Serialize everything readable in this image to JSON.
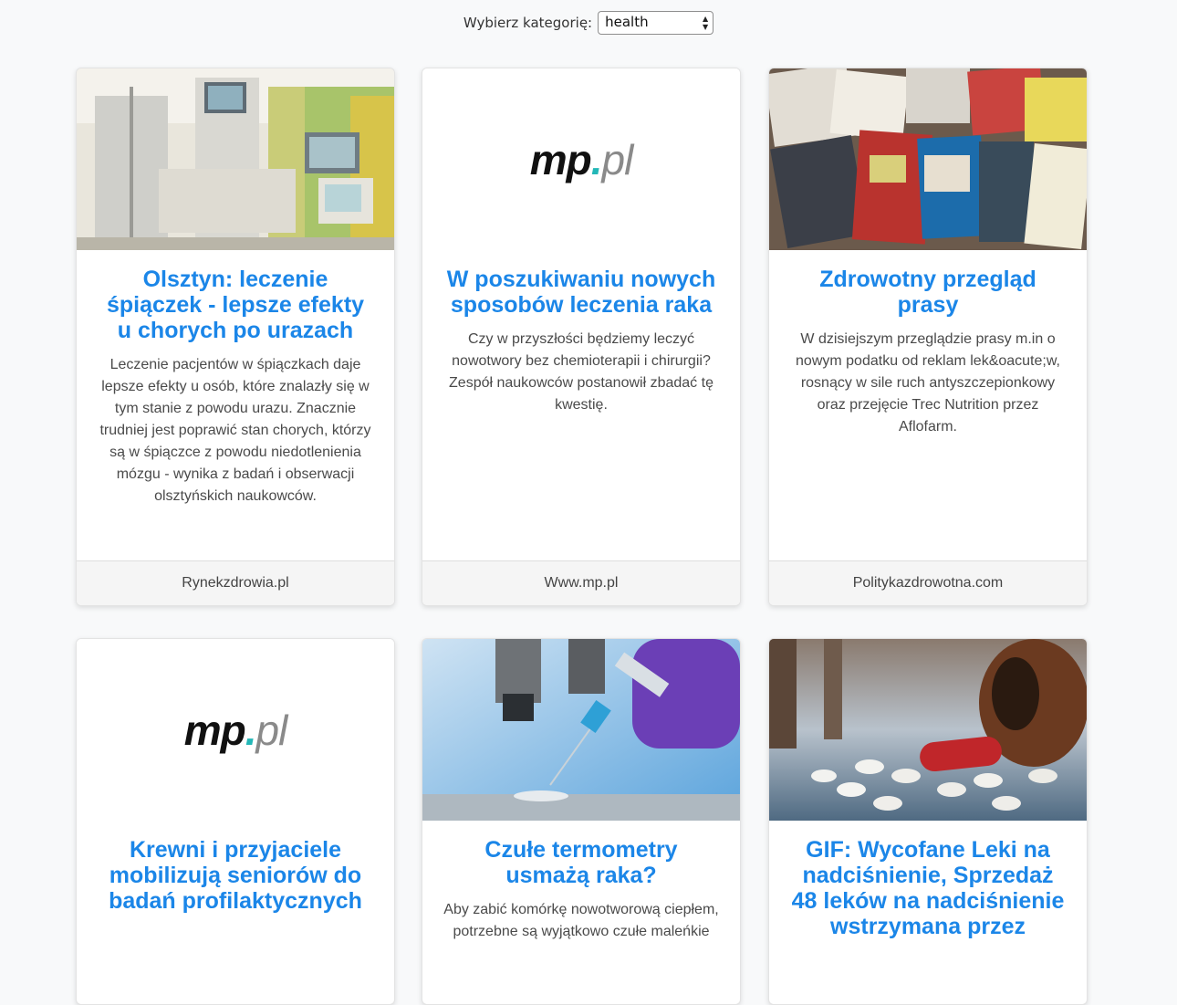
{
  "filter": {
    "label": "Wybierz kategorię:",
    "selected": "health"
  },
  "cards": [
    {
      "title": "Olsztyn: leczenie śpiączek - lepsze efekty u chorych po urazach",
      "description": "Leczenie pacjentów w śpiączkach daje lepsze efekty u osób, które znalazły się w tym stanie z powodu urazu. Znacznie trudniej jest poprawić stan chorych, którzy są w śpiączce z powodu niedotlenienia mózgu - wynika z badań i obserwacji olsztyńskich naukowców.",
      "source": "Rynekzdrowia.pl",
      "image": "hospital-icu-equipment"
    },
    {
      "title": "W poszukiwaniu nowych sposobów leczenia raka",
      "description": "Czy w przyszłości będziemy leczyć nowotwory bez chemioterapii i chirurgii? Zespół naukowców postanowił zbadać tę kwestię.",
      "source": "Www.mp.pl",
      "image": "mp-pl-logo"
    },
    {
      "title": "Zdrowotny przegląd prasy",
      "description": "W dzisiejszym przeglądzie prasy m.in o nowym podatku od reklam lek&oacute;w, rosnący w sile ruch antyszczepionkowy oraz przejęcie Trec Nutrition przez Aflofarm.",
      "source": "Politykazdrowotna.com",
      "image": "newspapers-stack"
    },
    {
      "title": "Krewni i przyjaciele mobilizują seniorów do badań profilaktycznych",
      "description": "",
      "source": "",
      "image": "mp-pl-logo"
    },
    {
      "title": "Czułe termometry usmażą raka?",
      "description": "Aby zabić komórkę nowotworową ciepłem, potrzebne są wyjątkowo czułe maleńkie",
      "source": "",
      "image": "microscope-syringe"
    },
    {
      "title": "GIF: Wycofane Leki na nadciśnienie, Sprzedaż 48 leków na nadciśnienie wstrzymana przez",
      "description": "",
      "source": "",
      "image": "pills-bottle"
    }
  ],
  "logo": {
    "mp": "mp",
    "dot": ".",
    "pl": "pl"
  },
  "colors": {
    "title": "#1b86e8",
    "logo_dot": "#23b7b7"
  }
}
